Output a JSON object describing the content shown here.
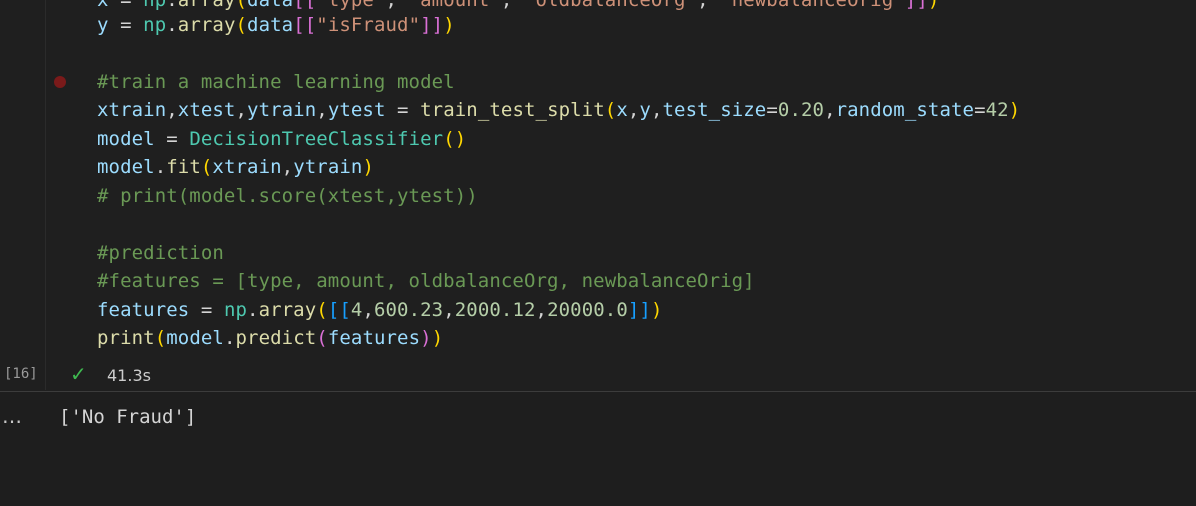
{
  "cell": {
    "execution_count": "[16]",
    "status": "success",
    "duration": "41.3s",
    "breakpoint_color": "#7a1a1a"
  },
  "code_lines": {
    "l0": {
      "a": "x",
      "b": " = ",
      "c": "np",
      "d": ".",
      "e": "array",
      "f": "(",
      "g": "data",
      "h": "[[",
      "i": "\"type\"",
      "j": ", ",
      "k": "\"amount\"",
      "l": ", ",
      "m": "\"oldbalanceOrg\"",
      "n": ", ",
      "o": "\"newbalanceOrig\"",
      "p": "]]",
      "q": ")"
    },
    "l1": {
      "a": "y",
      "b": " = ",
      "c": "np",
      "d": ".",
      "e": "array",
      "f": "(",
      "g": "data",
      "h": "[[",
      "i": "\"isFraud\"",
      "j": "]]",
      "k": ")"
    },
    "l3": "#train a machine learning model",
    "l4": {
      "a": "xtrain",
      "b": ",",
      "c": "xtest",
      "d": ",",
      "e": "ytrain",
      "f": ",",
      "g": "ytest",
      "h": " = ",
      "i": "train_test_split",
      "j": "(",
      "k": "x",
      "l": ",",
      "m": "y",
      "n": ",",
      "o": "test_size",
      "p": "=",
      "q": "0.20",
      "r": ",",
      "s": "random_state",
      "t": "=",
      "u": "42",
      "v": ")"
    },
    "l5": {
      "a": "model",
      "b": " = ",
      "c": "DecisionTreeClassifier",
      "d": "()"
    },
    "l6": {
      "a": "model",
      "b": ".",
      "c": "fit",
      "d": "(",
      "e": "xtrain",
      "f": ",",
      "g": "ytrain",
      "h": ")"
    },
    "l7": "# print(model.score(xtest,ytest))",
    "l9": "#prediction",
    "l10": "#features = [type, amount, oldbalanceOrg, newbalanceOrig]",
    "l11": {
      "a": "features",
      "b": " = ",
      "c": "np",
      "d": ".",
      "e": "array",
      "f": "(",
      "g": "[[",
      "h": "4",
      "i": ",",
      "j": "600.23",
      "k": ",",
      "l": "2000.12",
      "m": ",",
      "n": "20000.0",
      "o": "]]",
      "p": ")"
    },
    "l12": {
      "a": "print",
      "b": "(",
      "c": "model",
      "d": ".",
      "e": "predict",
      "f": "(",
      "g": "features",
      "h": ")",
      "i": ")"
    }
  },
  "output": {
    "more_icon": "…",
    "text": "['No Fraud']"
  },
  "icons": {
    "check": "✓"
  }
}
